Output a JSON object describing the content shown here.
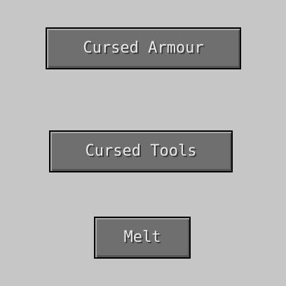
{
  "menu": {
    "buttons": [
      {
        "id": "cursed-armour",
        "label": "Cursed Armour"
      },
      {
        "id": "cursed-tools",
        "label": "Cursed Tools"
      },
      {
        "id": "melt",
        "label": "Melt"
      }
    ]
  },
  "colors": {
    "background": "#c6c6c6",
    "button_fill": "#6f6f6f",
    "button_border": "#000000",
    "button_text": "#e8e8e8"
  }
}
